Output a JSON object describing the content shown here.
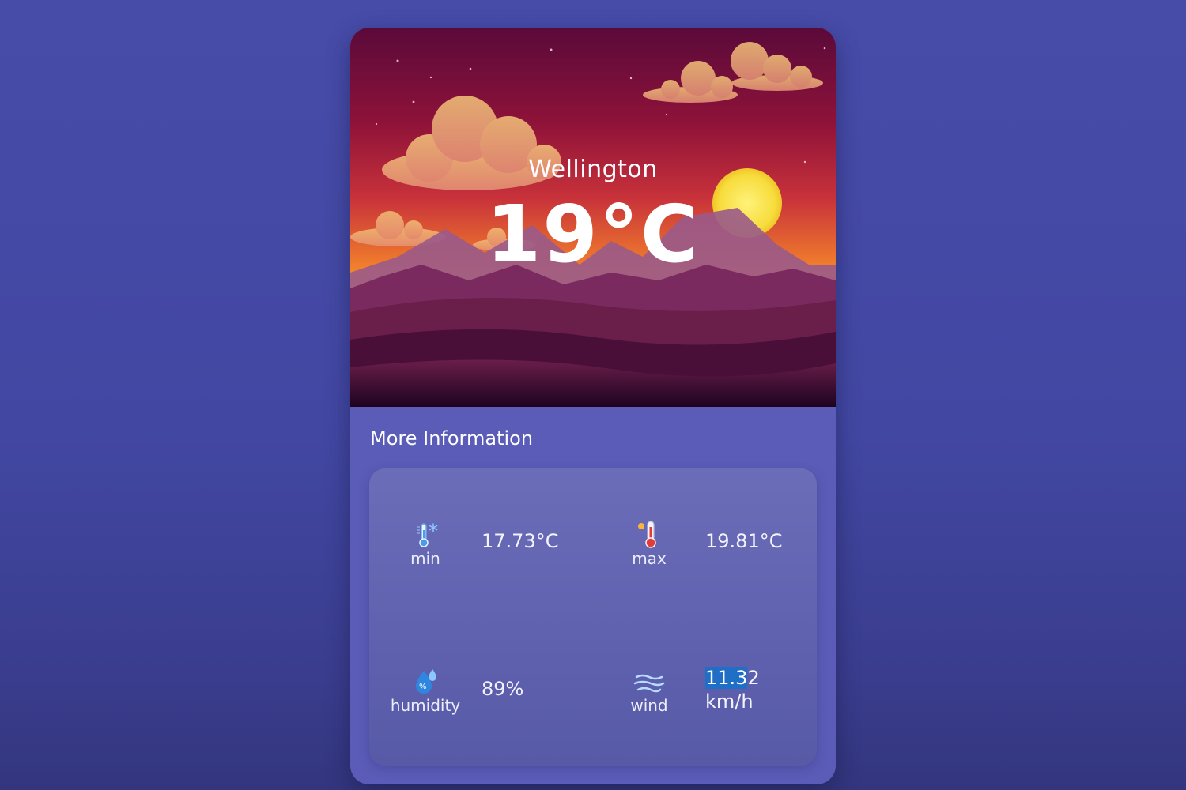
{
  "weather": {
    "city": "Wellington",
    "temperature": "19°C"
  },
  "more_info": {
    "title": "More Information",
    "min": {
      "label": "min",
      "value": "17.73°C",
      "icon": "thermometer-snowflake-icon"
    },
    "max": {
      "label": "max",
      "value": "19.81°C",
      "icon": "thermometer-hot-icon"
    },
    "humidity": {
      "label": "humidity",
      "value": "89%",
      "icon": "humidity-drop-icon"
    },
    "wind": {
      "label": "wind",
      "value_selected": "11.3",
      "value_rest": "2",
      "unit": "km/h",
      "icon": "wind-icon"
    }
  },
  "colors": {
    "page_background": "#474ca9",
    "card_background": "#5a5cb8",
    "text_selection": "#1f6fc7"
  }
}
